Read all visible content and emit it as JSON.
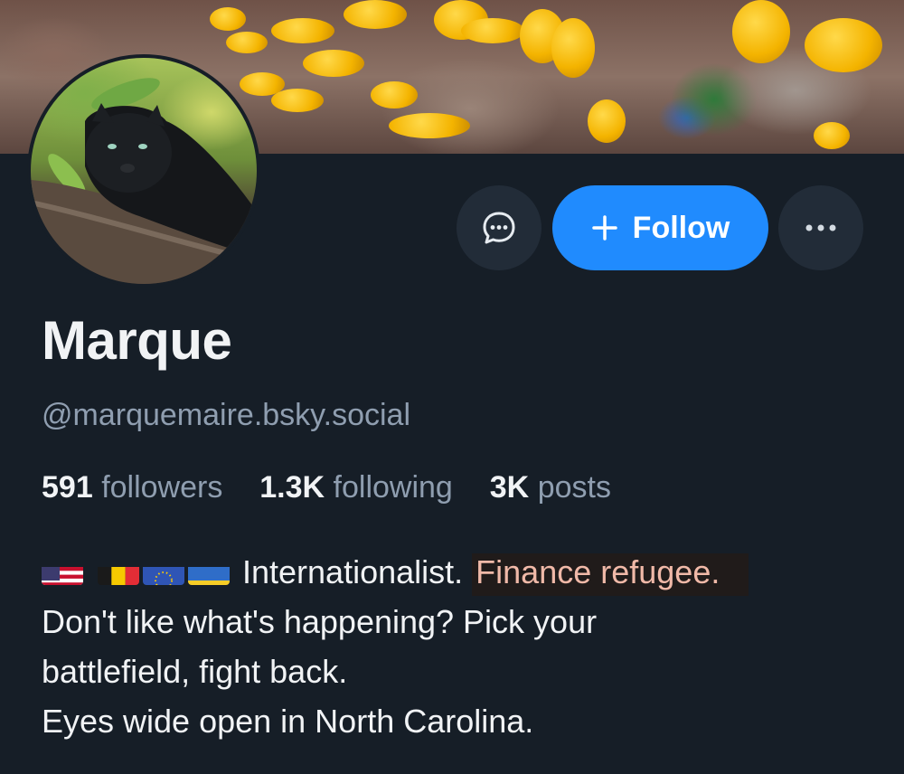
{
  "profile": {
    "display_name": "Marque",
    "handle": "@marquemaire.bsky.social",
    "stats": {
      "followers_count": "591",
      "followers_label": "followers",
      "following_count": "1.3K",
      "following_label": "following",
      "posts_count": "3K",
      "posts_label": "posts"
    },
    "bio": {
      "flags": [
        "us-flag",
        "belgium-flag",
        "eu-flag",
        "ukraine-flag"
      ],
      "line1_text": "Internationalist.",
      "line1_highlight": "Finance refugee.",
      "line2": "Don't like what's happening? Pick your",
      "line3": "battlefield, fight back.",
      "line4": "Eyes wide open in North Carolina."
    }
  },
  "actions": {
    "message_icon": "chat-bubble-icon",
    "follow_label": "Follow",
    "follow_icon": "plus-icon",
    "more_icon": "ellipsis-icon"
  },
  "colors": {
    "background": "#161e27",
    "accent": "#208bfe",
    "secondary_text": "#8f9eb0",
    "highlight_text": "#f0b9a8"
  }
}
